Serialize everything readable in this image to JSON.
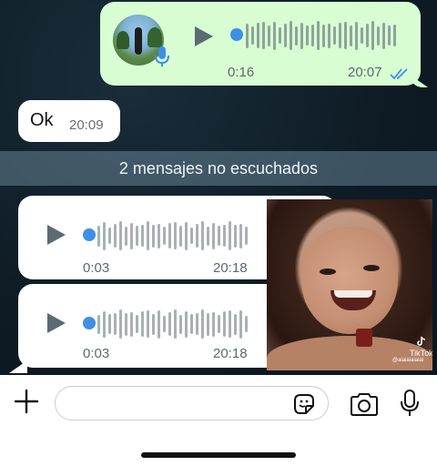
{
  "colors": {
    "outgoing_bubble": "#d9fdd3",
    "incoming_bubble": "#ffffff",
    "accent_blue": "#3f8ee8",
    "read_ticks": "#3f8ee8",
    "chat_background": "#0f1e28"
  },
  "messages": {
    "outgoing_voice": {
      "duration": "0:16",
      "time": "20:07",
      "status": "read",
      "progress": 0
    },
    "ok": {
      "text": "Ok",
      "time": "20:09"
    },
    "unread_banner": "2 mensajes no escuchados",
    "incoming_voice": [
      {
        "duration": "0:03",
        "time": "20:18",
        "progress": 0
      },
      {
        "duration": "0:03",
        "time": "20:18",
        "progress": 0
      }
    ]
  },
  "overlay": {
    "watermark": "TikTok",
    "watermark_user": "@aiaiaiaiaiai"
  },
  "composer": {
    "input_value": "",
    "icons": [
      "plus-icon",
      "sticker-icon",
      "camera-icon",
      "microphone-icon"
    ]
  }
}
